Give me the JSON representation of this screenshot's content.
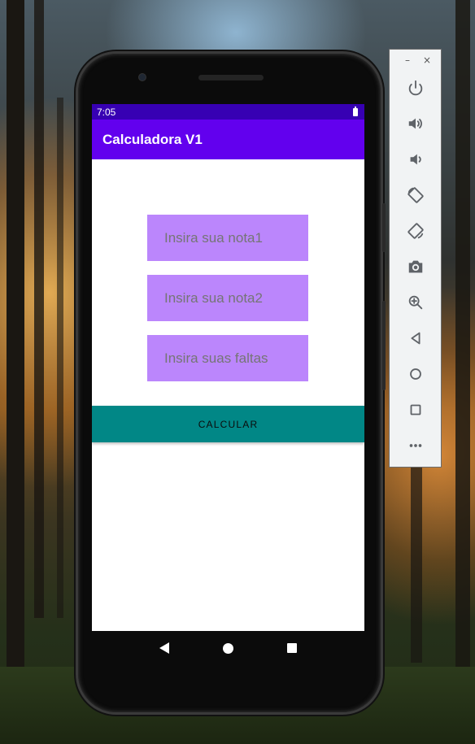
{
  "status_bar": {
    "time": "7:05",
    "battery_icon": "battery-full-icon"
  },
  "app_bar": {
    "title": "Calculadora V1"
  },
  "form": {
    "nota1_placeholder": "Insira sua nota1",
    "nota2_placeholder": "Insira sua nota2",
    "faltas_placeholder": "Insira suas faltas",
    "calculate_label": "CALCULAR"
  },
  "nav_bar": {
    "back_icon": "back-icon",
    "home_icon": "home-icon",
    "recents_icon": "recents-icon"
  },
  "emulator_toolbar": {
    "minimize_label": "–",
    "close_label": "×",
    "icons": [
      "power-icon",
      "volume-up-icon",
      "volume-down-icon",
      "rotate-left-icon",
      "rotate-right-icon",
      "screenshot-icon",
      "zoom-icon",
      "back-icon",
      "home-icon",
      "overview-icon",
      "more-icon"
    ]
  },
  "colors": {
    "status_bar": "#3700b3",
    "app_bar": "#6200ee",
    "input_bg": "#bb86fc",
    "button_bg": "#018786"
  }
}
